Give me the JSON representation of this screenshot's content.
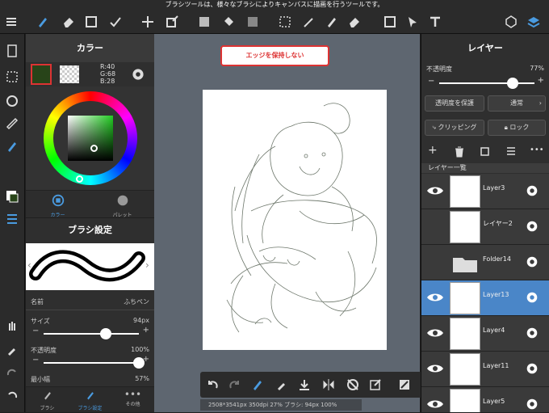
{
  "tooltip": "ブラシツールは、様々なブラシによりキャンバスに描画を行うツールです。",
  "color_panel": {
    "title": "カラー",
    "rgb_r": "R:40",
    "rgb_g": "G:68",
    "rgb_b": "B:28",
    "main_color": "#284419",
    "tabs": [
      "カラー",
      "パレット"
    ]
  },
  "brush_panel": {
    "title": "ブラシ設定",
    "name_label": "名前",
    "name_value": "ふちペン",
    "size_label": "サイズ",
    "size_value": "94px",
    "size_level": 0.65,
    "opacity_label": "不透明度",
    "opacity_value": "100%",
    "opacity_level": 1.0,
    "min_label": "最小幅",
    "min_value": "57%",
    "tabs": [
      "ブラシ",
      "ブラシ設定",
      "その他"
    ]
  },
  "canvas": {
    "edge_button": "エッジを保持しない",
    "status": "2508*3541px 350dpi 27% ブラシ: 94px 100%"
  },
  "layer_panel": {
    "title": "レイヤー",
    "opacity_label": "不透明度",
    "opacity_value": "77%",
    "opacity_level": 0.77,
    "protect_label": "透明度を保護",
    "blend_label": "通常",
    "clipping_label": "クリッピング",
    "lock_label": "ロック",
    "list_title": "レイヤー一覧",
    "layers": [
      {
        "name": "Layer3",
        "visible": true,
        "selected": false
      },
      {
        "name": "レイヤー2",
        "visible": false,
        "selected": false
      },
      {
        "name": "Folder14",
        "visible": false,
        "selected": false
      },
      {
        "name": "Layer13",
        "visible": true,
        "selected": true
      },
      {
        "name": "Layer4",
        "visible": true,
        "selected": false
      },
      {
        "name": "Layer11",
        "visible": true,
        "selected": false
      },
      {
        "name": "Layer5",
        "visible": true,
        "selected": false
      }
    ]
  },
  "accent": "#4a86c8"
}
